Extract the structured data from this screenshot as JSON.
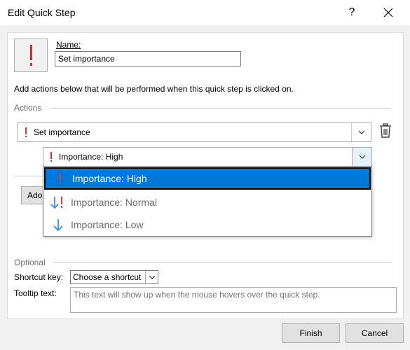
{
  "window": {
    "title": "Edit Quick Step",
    "help_label": "?"
  },
  "name": {
    "label": "Name:",
    "value": "Set importance"
  },
  "description": "Add actions below that will be performed when this quick step is clicked on.",
  "actions": {
    "group_label": "Actions",
    "action_value": "Set importance",
    "sub_value": "Importance: High",
    "add_button_label": "Ado"
  },
  "importance_options": [
    {
      "label": "Importance: High",
      "icon": "exclamation-icon",
      "selected": true
    },
    {
      "label": "Importance: Normal",
      "icon": "arrow-down-exclamation-icon",
      "selected": false
    },
    {
      "label": "Importance: Low",
      "icon": "arrow-down-icon",
      "selected": false
    }
  ],
  "optional": {
    "group_label": "Optional",
    "shortcut_label": "Shortcut key:",
    "shortcut_value": "Choose a shortcut",
    "tooltip_label": "Tooltip text:",
    "tooltip_placeholder": "This text will show up when the mouse hovers over the quick step."
  },
  "buttons": {
    "finish": "Finish",
    "cancel": "Cancel"
  },
  "colors": {
    "accent": "#0078d7",
    "importance_red": "#d32f2f",
    "low_blue": "#2e86de"
  }
}
